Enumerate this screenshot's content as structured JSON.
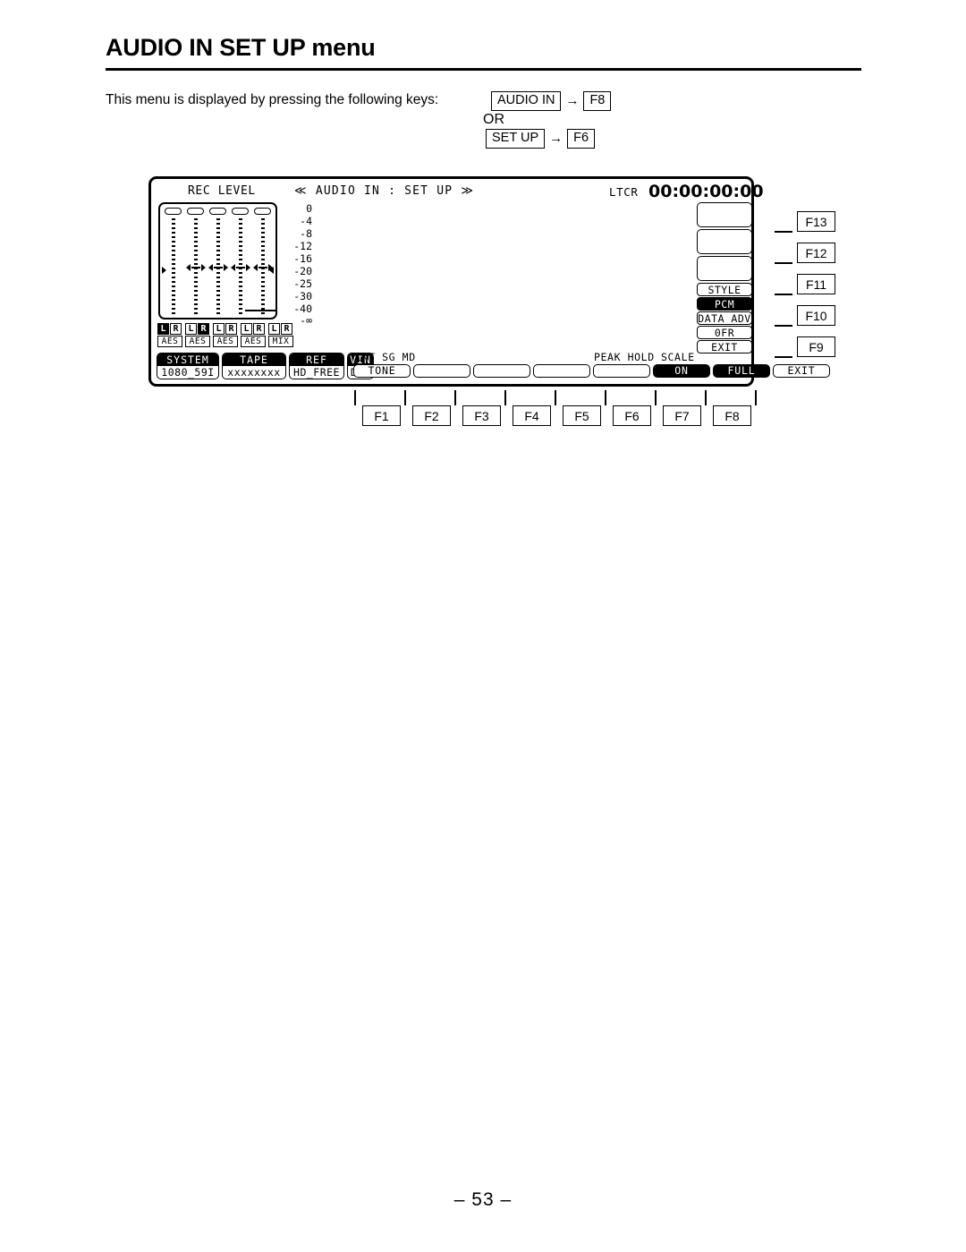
{
  "page": {
    "title": "AUDIO IN SET UP menu",
    "folio": "– 53 –"
  },
  "intro": {
    "text": "This menu is displayed by pressing the following keys:",
    "path1_key": "AUDIO IN",
    "path1_fkey": "F8",
    "or": "OR",
    "path2_key": "SET UP",
    "path2_fkey": "F6",
    "arrow": "→"
  },
  "lcd": {
    "rec_level_label": "REC LEVEL",
    "menu_title": "≪ AUDIO IN : SET UP ≫",
    "ltc_label": "LTCR",
    "ltc_value": "00:00:00:00",
    "scale_labels": [
      "0",
      "-4",
      "-8",
      "-12",
      "-16",
      "-20",
      "-25",
      "-30",
      "-40",
      "-∞"
    ],
    "channels": [
      {
        "left": "L",
        "right": "R",
        "active": "L",
        "source": "AES"
      },
      {
        "left": "L",
        "right": "R",
        "active": "R",
        "source": "AES"
      },
      {
        "left": "L",
        "right": "R",
        "active": "none",
        "source": "AES"
      },
      {
        "left": "L",
        "right": "R",
        "active": "none",
        "source": "AES"
      },
      {
        "left": "L",
        "right": "R",
        "active": "none",
        "source": "MIX"
      }
    ],
    "status_tiles": [
      {
        "header": "SYSTEM",
        "value": "1080_59I"
      },
      {
        "header": "TAPE",
        "value": "xxxxxxxx"
      },
      {
        "header": "REF",
        "value": "HD_FREE"
      },
      {
        "header": "VIN",
        "value": "DIG"
      }
    ],
    "soft_labels": {
      "int_sg_md": "INT SG MD",
      "peak_hold": "PEAK HOLD",
      "scale": "SCALE"
    },
    "soft_buttons": [
      {
        "label": "TONE",
        "inverted": false
      },
      {
        "label": "",
        "inverted": false
      },
      {
        "label": "",
        "inverted": false
      },
      {
        "label": "",
        "inverted": false
      },
      {
        "label": "",
        "inverted": false
      },
      {
        "label": "ON",
        "inverted": true
      },
      {
        "label": "FULL",
        "inverted": true
      },
      {
        "label": "EXIT",
        "inverted": false
      }
    ],
    "right_labels": [
      {
        "label": "STYLE",
        "inverted": false
      },
      {
        "label": "PCM",
        "inverted": true
      },
      {
        "label": "DATA ADV",
        "inverted": false
      },
      {
        "label": "0FR",
        "inverted": false
      },
      {
        "label": "EXIT",
        "inverted": false
      }
    ]
  },
  "fkeys": {
    "bottom": [
      "F1",
      "F2",
      "F3",
      "F4",
      "F5",
      "F6",
      "F7",
      "F8"
    ],
    "right": [
      "F13",
      "F12",
      "F11",
      "F10",
      "F9"
    ]
  }
}
